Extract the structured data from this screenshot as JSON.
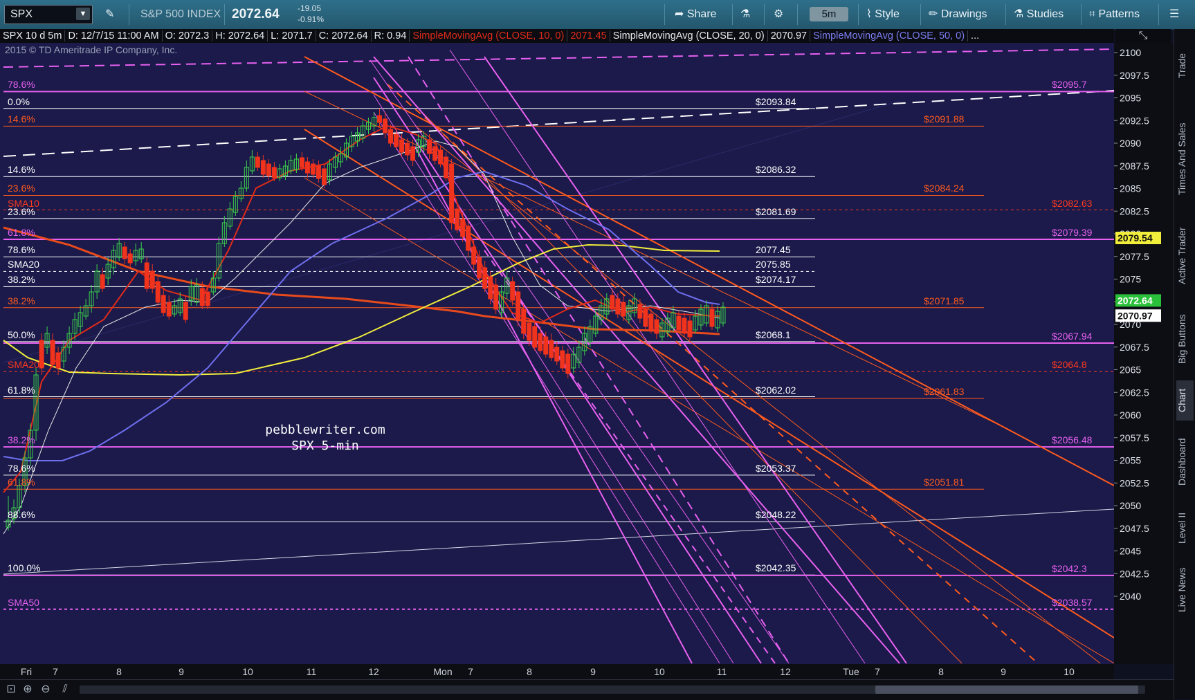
{
  "toolbar": {
    "symbol": "SPX",
    "index_name": "S&P 500 INDEX",
    "last_price": "2072.64",
    "change": "-19.05",
    "change_pct": "-0.91%",
    "share_label": "Share",
    "timeframe": "5m",
    "style_label": "Style",
    "drawings_label": "Drawings",
    "studies_label": "Studies",
    "patterns_label": "Patterns"
  },
  "info": {
    "title": "SPX 10 d 5m",
    "date": "D: 12/7/15 11:00 AM",
    "open": "O: 2072.3",
    "high": "H: 2072.64",
    "low": "L: 2071.7",
    "close": "C: 2072.64",
    "range": "R: 0.94",
    "sma10_label": "SimpleMovingAvg (CLOSE, 10, 0)",
    "sma10_value": "2071.45",
    "sma20_label": "SimpleMovingAvg (CLOSE, 20, 0)",
    "sma20_value": "2070.97",
    "sma50_label": "SimpleMovingAvg (CLOSE, 50, 0)",
    "sma50_value": "..."
  },
  "copyright": "2015 © TD Ameritrade IP Company, Inc.",
  "watermark": {
    "line1": "pebblewriter.com",
    "line2": "SPX 5-min"
  },
  "colors": {
    "background": "#1b1a4a",
    "up_candle": "#3bd34a",
    "down_candle": "#f0331d",
    "sma10": "#e02a1a",
    "sma20": "#e8e8e8",
    "sma50": "#6f6ff0",
    "sma200": "#e84a1c",
    "yellow_ma": "#f2ee3c",
    "magenta": "#e860f0",
    "orange": "#ff5a1e"
  },
  "side_tabs": [
    "Trade",
    "Times And Sales",
    "Active Trader",
    "Big Buttons",
    "Chart",
    "Dashboard",
    "Level II",
    "Live News"
  ],
  "active_side_tab": "Chart",
  "price_axis": {
    "ticks": [
      "2100",
      "2097.5",
      "2095",
      "2092.5",
      "2090",
      "2087.5",
      "2085",
      "2082.5",
      "2080",
      "2077.5",
      "2075",
      "2072.5",
      "2070",
      "2067.5",
      "2065",
      "2062.5",
      "2060",
      "2057.5",
      "2055",
      "2052.5",
      "2050",
      "2047.5",
      "2045",
      "2042.5",
      "2040"
    ],
    "last_tag": "2072.64",
    "sma20_tag": "2070.97",
    "yellow_tag": "2079.54"
  },
  "time_axis": {
    "labels": [
      "Fri",
      "7",
      "8",
      "9",
      "10",
      "11",
      "12",
      "Mon",
      "7",
      "8",
      "9",
      "10",
      "11",
      "12",
      "Tue",
      "7",
      "8",
      "9",
      "10"
    ]
  },
  "levels": [
    {
      "left_label": "78.6%",
      "right_label": "$2095.7",
      "price": 2095.7,
      "color": "#e860f0"
    },
    {
      "left_label": "0.0%",
      "right_label": "$2093.84",
      "price": 2093.84,
      "color": "#ffffff"
    },
    {
      "left_label": "14.6%",
      "right_label": "$2091.88",
      "price": 2091.88,
      "color": "#ff5a1e"
    },
    {
      "left_label": "14.6%",
      "right_label": "$2086.32",
      "price": 2086.32,
      "color": "#ffffff"
    },
    {
      "left_label": "23.6%",
      "right_label": "$2084.24",
      "price": 2084.24,
      "color": "#ff5a1e"
    },
    {
      "left_label": "SMA10",
      "right_label": "$2082.63",
      "price": 2082.63,
      "color": "#ff3a1e"
    },
    {
      "left_label": "23.6%",
      "right_label": "$2081.69",
      "price": 2081.69,
      "color": "#ffffff"
    },
    {
      "left_label": "61.8%",
      "right_label": "$2079.39",
      "price": 2079.39,
      "color": "#e860f0"
    },
    {
      "left_label": "78.6%",
      "right_label": "2077.45",
      "price": 2077.45,
      "color": "#ffffff"
    },
    {
      "left_label": "SMA20",
      "right_label": "2075.85",
      "price": 2075.85,
      "color": "#ffffff"
    },
    {
      "left_label": "38.2%",
      "right_label": "$2074.17",
      "price": 2074.17,
      "color": "#ffffff"
    },
    {
      "left_label": "38.2%",
      "right_label": "$2071.85",
      "price": 2071.85,
      "color": "#ff5a1e"
    },
    {
      "left_label": "50.0%",
      "right_label": "$2068.1",
      "price": 2068.1,
      "color": "#ffffff"
    },
    {
      "left_label": "",
      "right_label": "$2067.94",
      "price": 2067.94,
      "color": "#e860f0"
    },
    {
      "left_label": "SMA200",
      "right_label": "$2064.8",
      "price": 2064.8,
      "color": "#ff3a1e"
    },
    {
      "left_label": "61.8%",
      "right_label": "$2062.02",
      "price": 2062.02,
      "color": "#ffffff"
    },
    {
      "left_label": "",
      "right_label": "$2061.83",
      "price": 2061.83,
      "color": "#ff5a1e"
    },
    {
      "left_label": "38.2%",
      "right_label": "$2056.48",
      "price": 2056.48,
      "color": "#e860f0"
    },
    {
      "left_label": "78.6%",
      "right_label": "$2053.37",
      "price": 2053.37,
      "color": "#ffffff"
    },
    {
      "left_label": "61.8%",
      "right_label": "$2051.81",
      "price": 2051.81,
      "color": "#ff5a1e"
    },
    {
      "left_label": "88.6%",
      "right_label": "$2048.22",
      "price": 2048.22,
      "color": "#ffffff"
    },
    {
      "left_label": "100.0%",
      "right_label": "$2042.35",
      "price": 2042.35,
      "color": "#ffffff"
    },
    {
      "left_label": "",
      "right_label": "$2042.3",
      "price": 2042.3,
      "color": "#e860f0"
    },
    {
      "left_label": "SMA50",
      "right_label": "$2038.57",
      "price": 2038.57,
      "color": "#e860f0"
    }
  ]
}
